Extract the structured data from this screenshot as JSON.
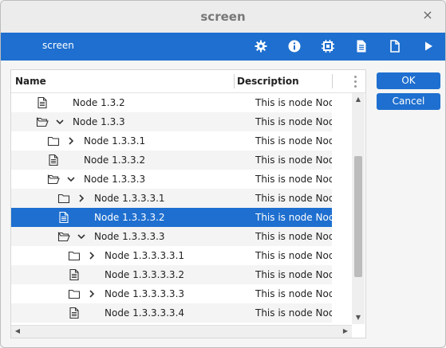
{
  "window": {
    "title": "screen",
    "close_glyph": "×"
  },
  "toolbar": {
    "label": "screen",
    "icons": [
      "gear-icon",
      "info-icon",
      "chip-icon",
      "document-icon",
      "blank-document-icon",
      "play-icon"
    ]
  },
  "tree": {
    "columns": {
      "name": "Name",
      "description": "Description"
    },
    "rows": [
      {
        "label": "Node 1.3.2",
        "description": "This is node Nod",
        "icon": "file-icon",
        "expander": "none"
      },
      {
        "label": "Node 1.3.3",
        "description": "This is node Nod",
        "icon": "folder-open-icon",
        "expander": "expanded"
      },
      {
        "label": "Node 1.3.3.1",
        "description": "This is node Nod",
        "icon": "folder-icon",
        "expander": "collapsed"
      },
      {
        "label": "Node 1.3.3.2",
        "description": "This is node Nod",
        "icon": "file-icon",
        "expander": "none"
      },
      {
        "label": "Node 1.3.3.3",
        "description": "This is node Nod",
        "icon": "folder-open-icon",
        "expander": "expanded"
      },
      {
        "label": "Node 1.3.3.3.1",
        "description": "This is node Nod",
        "icon": "folder-icon",
        "expander": "collapsed"
      },
      {
        "label": "Node 1.3.3.3.2",
        "description": "This is node Nod",
        "icon": "file-icon",
        "expander": "none",
        "selected": true
      },
      {
        "label": "Node 1.3.3.3.3",
        "description": "This is node Nod",
        "icon": "folder-open-icon",
        "expander": "expanded"
      },
      {
        "label": "Node 1.3.3.3.3.1",
        "description": "This is node Nod",
        "icon": "folder-icon",
        "expander": "collapsed"
      },
      {
        "label": "Node 1.3.3.3.3.2",
        "description": "This is node Nod",
        "icon": "file-icon",
        "expander": "none"
      },
      {
        "label": "Node 1.3.3.3.3.3",
        "description": "This is node Nod",
        "icon": "folder-icon",
        "expander": "collapsed"
      },
      {
        "label": "Node 1.3.3.3.3.4",
        "description": "This is node Nod",
        "icon": "file-icon",
        "expander": "none"
      }
    ]
  },
  "buttons": {
    "ok": "OK",
    "cancel": "Cancel"
  },
  "colors": {
    "accent": "#1e6fcf",
    "selection_text": "#ffffff"
  }
}
